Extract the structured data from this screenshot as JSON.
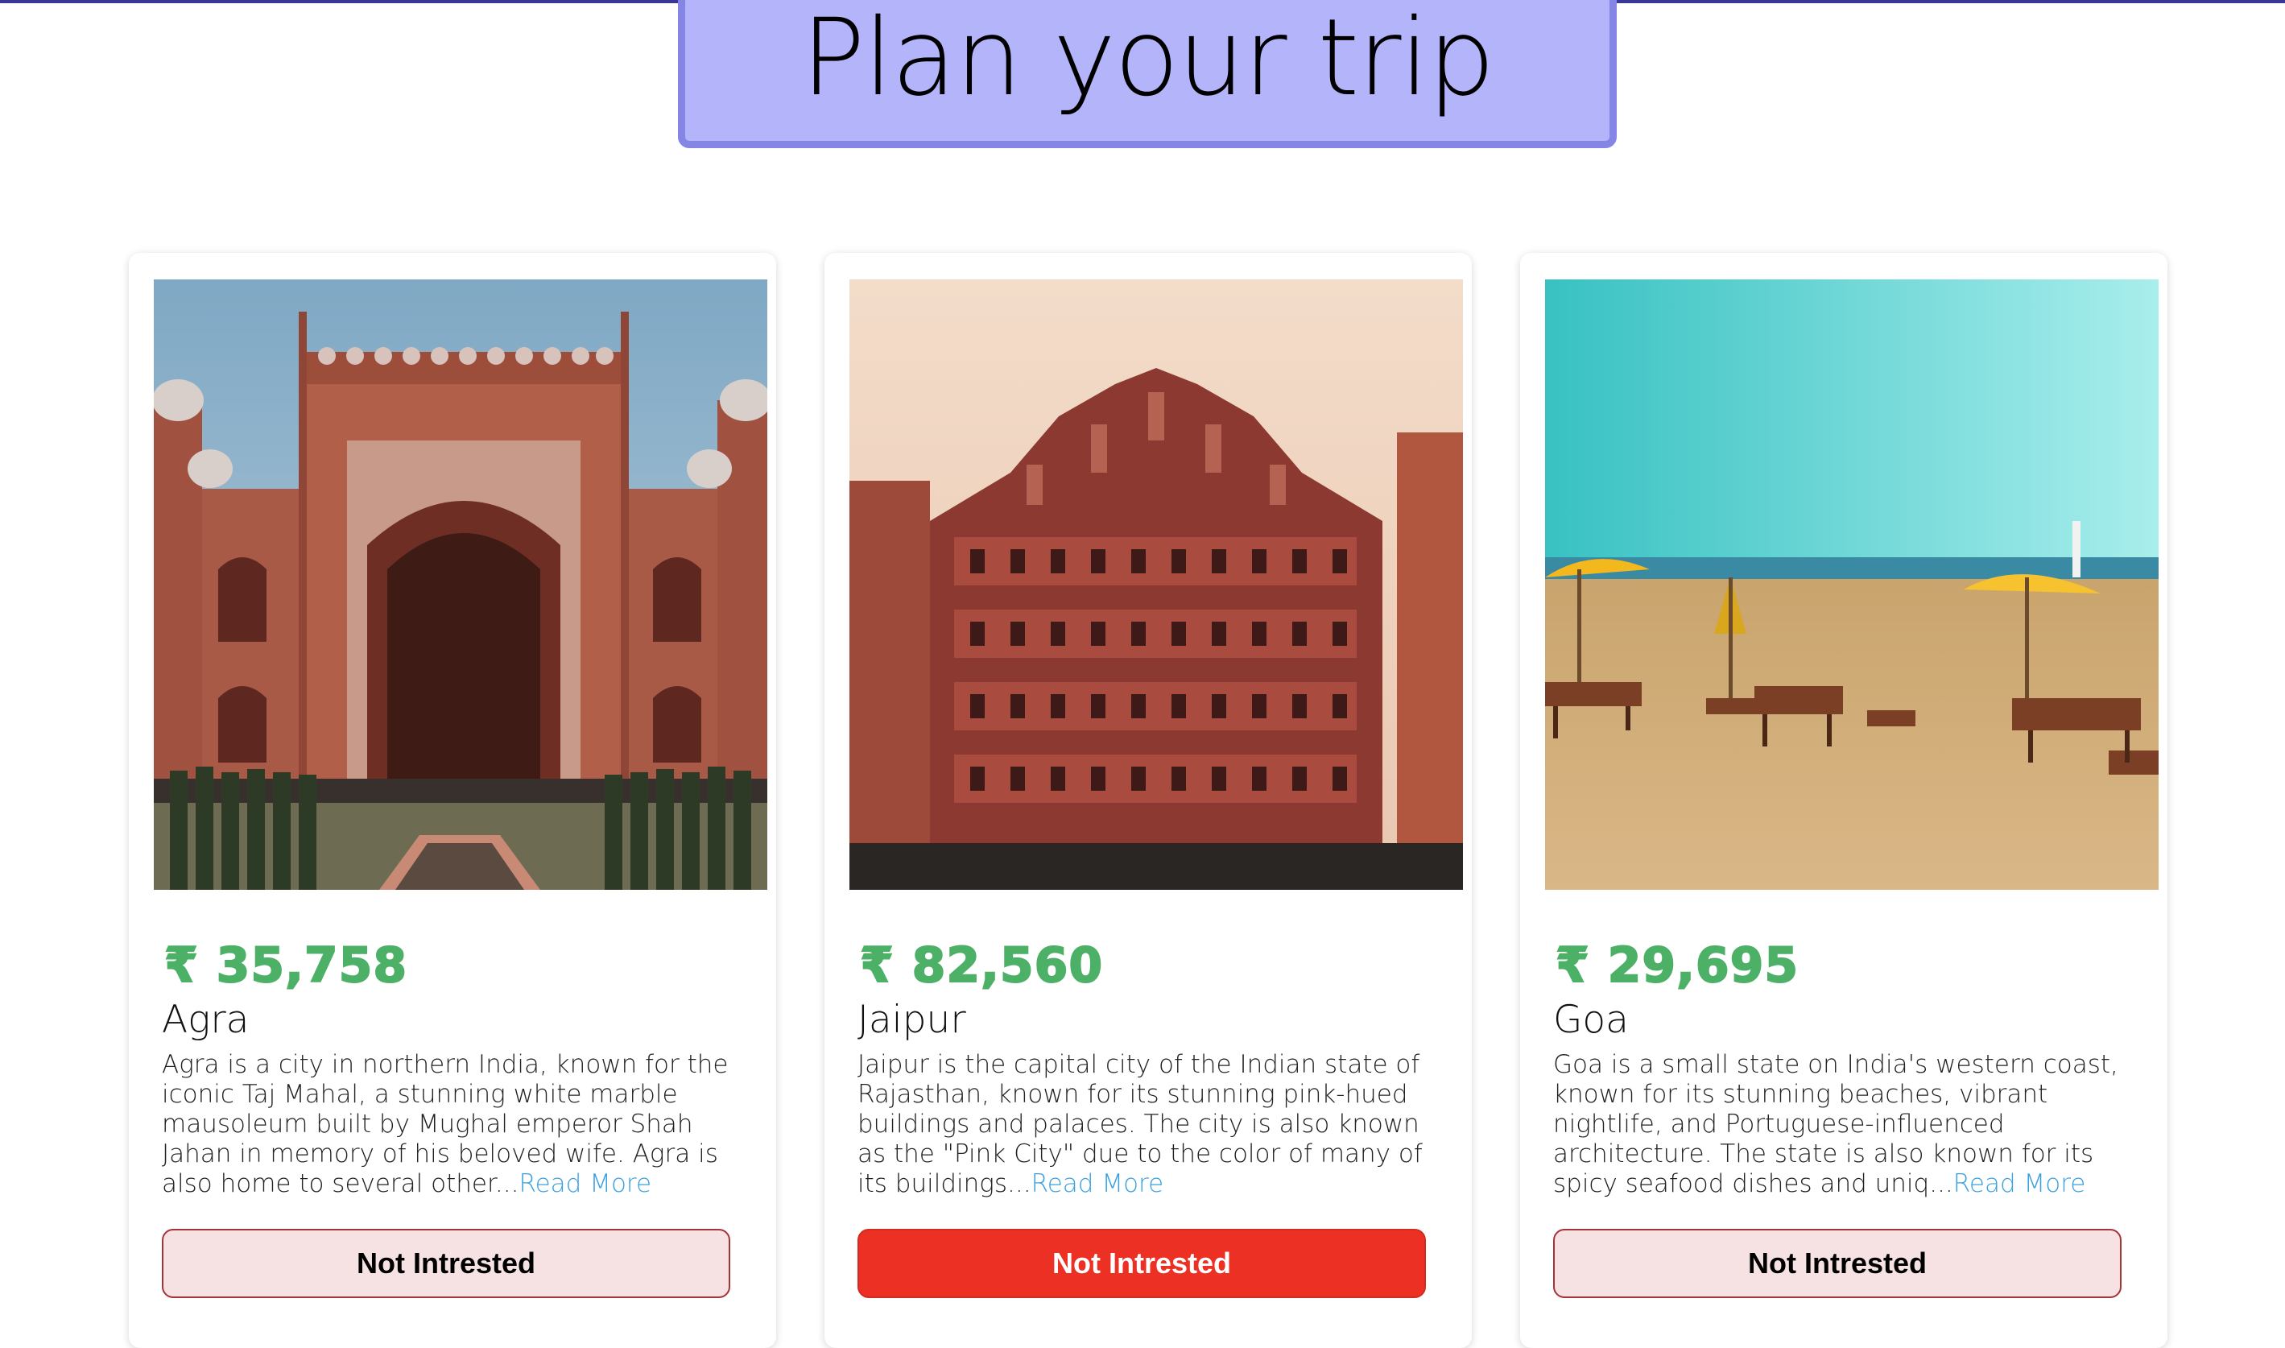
{
  "header": {
    "title": "Plan your trip",
    "title_bg": "#b4b4fa",
    "title_border": "#8585e6",
    "top_rule_color": "#3b3796"
  },
  "cards": [
    {
      "price": "₹ 35,758",
      "city": "Agra",
      "description": "Agra is a city in northern India, known for the iconic Taj Mahal, a stunning white marble mausoleum built by Mughal emperor Shah Jahan in memory of his beloved wife. Agra is also home to several other...",
      "read_more": "Read More",
      "button_label": "Not Intrested",
      "button_state": "default",
      "image": "red-sandstone-gate-photo"
    },
    {
      "price": "₹ 82,560",
      "city": "Jaipur",
      "description": "Jaipur is the capital city of the Indian state of Rajasthan, known for its stunning pink-hued buildings and palaces. The city is also known as the \"Pink City\" due to the color of many of its buildings...",
      "read_more": "Read More",
      "button_label": "Not Intrested",
      "button_state": "active",
      "image": "hawa-mahal-palace-photo"
    },
    {
      "price": "₹ 29,695",
      "city": "Goa",
      "description": "Goa is a small state on India's western coast, known for its stunning beaches, vibrant nightlife, and Portuguese-influenced architecture. The state is also known for its spicy seafood dishes and uniq...",
      "read_more": "Read More",
      "button_label": "Not Intrested",
      "button_state": "default",
      "image": "beach-umbrellas-photo"
    }
  ],
  "colors": {
    "price_green": "#4cb066",
    "link_blue": "#3aa0e0",
    "button_default_bg": "#f6e2e2",
    "button_active_bg": "#ec3124"
  }
}
